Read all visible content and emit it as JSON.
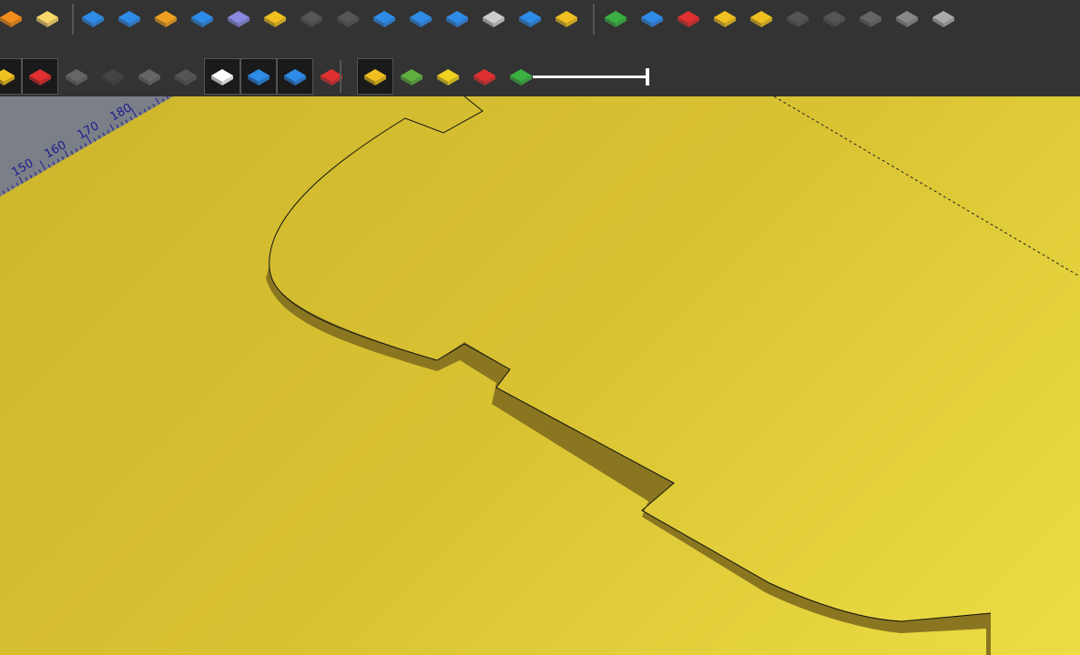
{
  "toolbar": {
    "row1": [
      {
        "icon": "addon-manager-icon",
        "color": "#f28c1c"
      },
      {
        "icon": "favorite-folder-icon",
        "color": "#f7d76a"
      },
      {
        "icon": "pad-icon",
        "color": "#2f8be8"
      },
      {
        "icon": "revolution-icon",
        "color": "#2f8be8"
      },
      {
        "icon": "grid-pocket-icon",
        "color": "#f0a020"
      },
      {
        "icon": "extrude-up-icon",
        "color": "#2f8be8"
      },
      {
        "icon": "hole-icon",
        "color": "#8a8ae0"
      },
      {
        "icon": "pin-icon",
        "color": "#f0c020"
      },
      {
        "icon": "disabled-hole-icon",
        "color": "#555555"
      },
      {
        "icon": "disabled-small-hole-icon",
        "color": "#555555"
      },
      {
        "icon": "fillet-icon",
        "color": "#2f8be8"
      },
      {
        "icon": "sheet-bend-icon",
        "color": "#2f8be8"
      },
      {
        "icon": "loft-icon",
        "color": "#2f8be8"
      },
      {
        "icon": "screw-icon",
        "color": "#cccccc"
      },
      {
        "icon": "thickness-icon",
        "color": "#2f8be8"
      },
      {
        "icon": "layer-stack-icon",
        "color": "#f0c020"
      },
      {
        "icon": "add-icon",
        "color": "#3cb043"
      },
      {
        "icon": "measure-icon",
        "color": "#2f8be8"
      },
      {
        "icon": "gear-check-icon",
        "color": "#e03030"
      },
      {
        "icon": "arrow-path-icon",
        "color": "#f0c020"
      },
      {
        "icon": "mirror-icon",
        "color": "#f0c020"
      },
      {
        "icon": "disabled-select-icon",
        "color": "#555555"
      },
      {
        "icon": "disabled-clock-icon",
        "color": "#555555"
      },
      {
        "icon": "arc-icon",
        "color": "#666666"
      },
      {
        "icon": "rounded-corner-icon",
        "color": "#888888"
      },
      {
        "icon": "point-icon",
        "color": "#aaaaaa"
      }
    ],
    "row2": [
      {
        "icon": "partial-icon",
        "color": "#f0c020",
        "boxed": true
      },
      {
        "icon": "axes-icon",
        "color": "#e03030",
        "boxed": true
      },
      {
        "icon": "puzzle-icon",
        "color": "#666666"
      },
      {
        "icon": "cylinder-icon",
        "color": "#444444"
      },
      {
        "icon": "box-icon",
        "color": "#666666"
      },
      {
        "icon": "joystick-icon",
        "color": "#555555"
      },
      {
        "icon": "clock-page-icon",
        "color": "#ffffff",
        "boxed": true
      },
      {
        "icon": "star-icon",
        "color": "#2f8be8",
        "boxed": true
      },
      {
        "icon": "layer-outline-icon",
        "color": "#2f8be8",
        "boxed": true
      },
      {
        "icon": "layer-red-icon",
        "color": "#e03030"
      },
      {
        "icon": "yellow-plate-icon",
        "color": "#f0c020",
        "boxed": true
      },
      {
        "icon": "shapes-icon",
        "color": "#5fb040"
      },
      {
        "icon": "star-search-icon",
        "color": "#f0d020"
      },
      {
        "icon": "pyramid-icon",
        "color": "#e03030"
      },
      {
        "icon": "layers-colored-icon",
        "color": "#3cb043"
      }
    ],
    "slider_value": 1.0
  },
  "viewport": {
    "background": "#d4bd30",
    "ruler_labels": [
      "150",
      "160",
      "170",
      "180"
    ]
  }
}
